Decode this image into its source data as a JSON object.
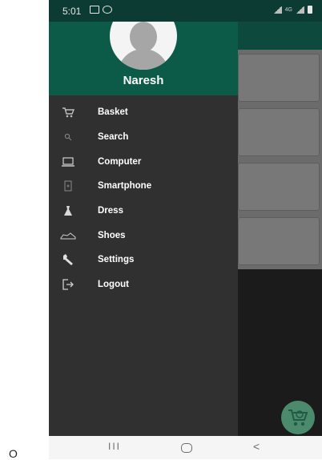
{
  "status_bar": {
    "time": "5:01",
    "left_icons": [
      "gallery-icon",
      "whatsapp-icon"
    ],
    "right_icons": [
      "signal-icon",
      "data-icon",
      "signal-icon",
      "battery-icon"
    ]
  },
  "drawer": {
    "user_name": "Naresh",
    "items": [
      {
        "label": "Basket",
        "icon": "basket-icon"
      },
      {
        "label": "Search",
        "icon": "search-icon"
      },
      {
        "label": "Computer",
        "icon": "laptop-icon"
      },
      {
        "label": "Smartphone",
        "icon": "smartphone-icon"
      },
      {
        "label": "Dress",
        "icon": "dress-icon"
      },
      {
        "label": "Shoes",
        "icon": "shoe-icon"
      },
      {
        "label": "Settings",
        "icon": "wrench-icon"
      },
      {
        "label": "Logout",
        "icon": "logout-icon"
      }
    ]
  },
  "fab": {
    "icon": "cart-icon"
  },
  "nav_bar": {
    "recent": "III",
    "back": "<"
  },
  "outside": {
    "mark": "O"
  },
  "colors": {
    "header_green": "#0c5a48",
    "drawer_bg": "#303030",
    "fab_green": "#4b8a6d"
  }
}
